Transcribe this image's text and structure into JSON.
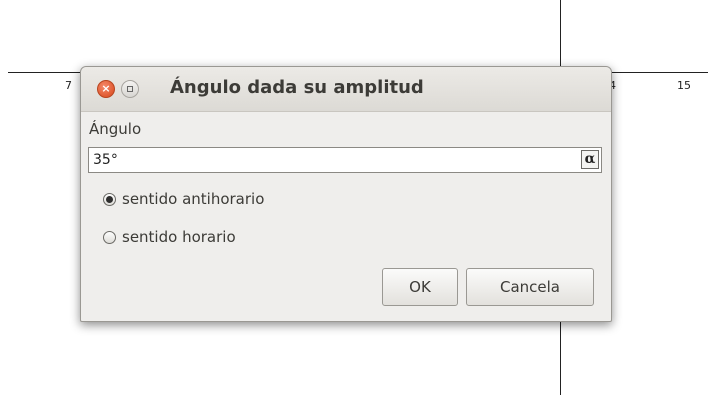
{
  "background": {
    "tick_labels": [
      "7",
      "4",
      "15"
    ]
  },
  "dialog": {
    "title": "Ángulo dada su amplitud",
    "close_glyph": "×",
    "field_label": "Ángulo",
    "angle_value": "35°",
    "alpha_button": "α",
    "options": [
      {
        "label": "sentido antihorario",
        "checked": true
      },
      {
        "label": "sentido horario",
        "checked": false
      }
    ],
    "ok_label": "OK",
    "cancel_label": "Cancela"
  },
  "colors": {
    "close_button": "#e05a32",
    "dialog_bg": "#efeeec"
  }
}
